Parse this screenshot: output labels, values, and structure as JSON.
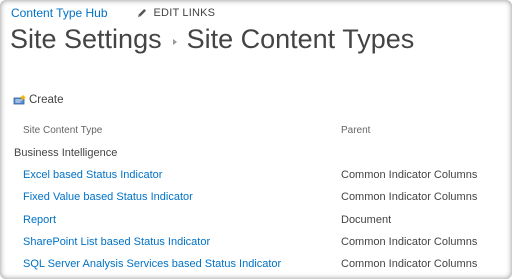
{
  "header": {
    "hub_link": "Content Type Hub",
    "edit_links": "EDIT LINKS"
  },
  "title": {
    "part1": "Site Settings",
    "part2": "Site Content Types"
  },
  "toolbar": {
    "create_label": "Create"
  },
  "table": {
    "columns": [
      "Site Content Type",
      "Parent"
    ],
    "group": "Business Intelligence",
    "rows": [
      {
        "name": "Excel based Status Indicator",
        "parent": "Common Indicator Columns"
      },
      {
        "name": "Fixed Value based Status Indicator",
        "parent": "Common Indicator Columns"
      },
      {
        "name": "Report",
        "parent": "Document"
      },
      {
        "name": "SharePoint List based Status Indicator",
        "parent": "Common Indicator Columns"
      },
      {
        "name": "SQL Server Analysis Services based Status Indicator",
        "parent": "Common Indicator Columns"
      }
    ]
  },
  "colors": {
    "link": "#0072c6",
    "text": "#444444"
  },
  "icons": [
    "pencil-icon",
    "breadcrumb-arrow-icon",
    "create-icon"
  ]
}
